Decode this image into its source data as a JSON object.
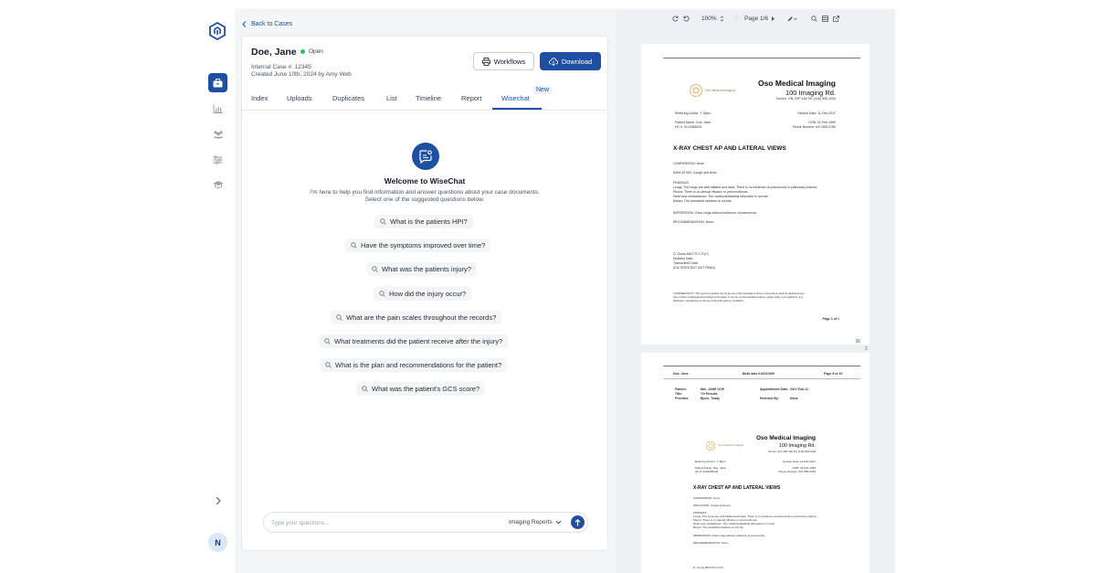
{
  "back_link": "Back to Cases",
  "case": {
    "name": "Doe, Jane",
    "status": "Open",
    "internal_id": "Internal Case #: 12345",
    "created": "Created June 10th, 2024 by Amy Web",
    "workflows_label": "Workflows",
    "download_label": "Download"
  },
  "tabs": [
    "Index",
    "Uploads",
    "Duplicates",
    "List",
    "Timeline",
    "Report",
    "Wisechat"
  ],
  "new_badge": "New",
  "wisechat": {
    "title": "Welcome to WiseChat",
    "description": "I'm here to help you find information and answer questions about your case documents. Select one of the suggested questions below.",
    "questions": [
      "What is the patients HPI?",
      "Have the symptoms improved over time?",
      "What was the patients injury?",
      "How did the injury occur?",
      "What are the pain scales throughout the records?",
      "What treatments did the patient receive after the injury?",
      "What is the plan and recommendations for the patient?",
      "What was the patient's GCS score?"
    ],
    "input_placeholder": "Type your questions...",
    "doc_selector": "Imaging Reports"
  },
  "sidebar": {
    "avatar_initial": "N"
  },
  "viewer": {
    "zoom": "100%",
    "page_indicator": "Page 1/6",
    "page1": {
      "clinic_name": "Oso Medical Imaging",
      "address": "100 Imaging Rd.",
      "city": "Toronto, ON, Z9P 4A0  Tel: (416) 555-1000",
      "logo_text": "Oso Medical Imaging",
      "ref_doctor": "Referring Doctor: T. Bjorn",
      "service_date": "Service Date: 11-Feb-2017",
      "patient": "Patient Name: Doe, Jane",
      "hc": "HC #: 0123455234",
      "dob": "DOB: 01-Feb-1999",
      "phone": "Phone Number: 647-555-0789",
      "report_title": "X-RAY CHEST AP AND LATERAL VIEWS",
      "comparison": "COMPARISON: None",
      "indication": "INDICATION: Cough and fever",
      "findings_head": "FINDINGS:",
      "findings": [
        "Lungs: The lungs are well inflated and clear. There is no evidence of pneumonia or pulmonary edema.",
        "Pleura: There is no pleural effusion or pneumothorax.",
        "Heart and mediastinum: The cardiomediastinal silhouette is normal.",
        "Bones: The visualized skeleton is normal."
      ],
      "impression": "IMPRESSION: Clear lungs without evidence of pneumonia.",
      "recommendation": "RECOMMENDATION: None.",
      "signature": [
        "D. Ouma MD.F.R.C.P.(C)",
        "Dictated Date:",
        "Transcribed Date:",
        "(DICTATED BUT NOT READ)"
      ],
      "confidentiality": [
        "CONFIDENTIALITY: This report is intended only for the use of the individual to whom or the entity to which its addressed and",
        "does contain confidential and privileged information. If you are not the intended recipient, please notify us by telephone. Any",
        "distribution, reproduction or the use of this information is prohibited."
      ],
      "page_of": "Page 1 of 1",
      "side_numbers": [
        "36",
        "2"
      ]
    },
    "page2": {
      "header_name": "Doe, Jane",
      "header_birth": "Birth date 01/02/1999",
      "header_page": "Page 8 of 10",
      "rows": [
        [
          "Patient:",
          "Mrs. JANE DOE",
          "Appointment Date:",
          "2017-Feb-11"
        ],
        [
          "Title:",
          "*Xr Results",
          "Referred By:",
          "None"
        ],
        [
          "Provider:",
          "Bjorn, Teddy",
          "",
          ""
        ]
      ],
      "clinic_name": "Oso Medical Imaging",
      "address": "100 Imaging Rd.",
      "city": "Toronto, ON, Z9P 4A0  Tel: (416) 555-1000",
      "logo_text": "Oso Medical Imaging",
      "ref_doctor": "Referring Doctor: T. Bjorn",
      "service_date": "Service Date: 11-Feb-2017",
      "patient": "Patient Name: Doe, Jane",
      "hc": "HC #: 0123455234",
      "dob": "DOB: 01-Feb-1999",
      "phone": "Phone Number: 647-555-0789",
      "report_title": "X-RAY CHEST AP AND LATERAL VIEWS",
      "comparison": "COMPARISON: None",
      "indication": "INDICATION: Cough and fever",
      "findings_head": "FINDINGS:",
      "findings": [
        "Lungs: The lungs are well inflated and clear. There is no evidence of pneumonia or pulmonary edema.",
        "Pleura: There is no pleural effusion or pneumothorax.",
        "Heart and mediastinum: The cardiomediastinal silhouette is normal.",
        "Bones: The visualized skeleton is normal."
      ],
      "impression": "IMPRESSION: Clear lungs without evidence of pneumonia.",
      "recommendation": "RECOMMENDATION: None.",
      "signature": "D. Ouma MD.F.R.C.P.(C)"
    }
  },
  "colors": {
    "accent": "#1e4fa1",
    "status_open": "#22c55e",
    "panel_bg": "#f4f5f7",
    "viewer_bg": "#eef0f3"
  }
}
